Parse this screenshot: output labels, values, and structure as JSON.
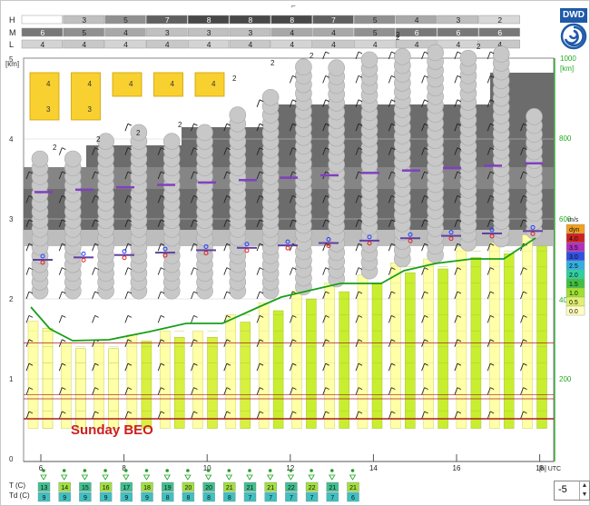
{
  "logo": {
    "text": "DWD",
    "icon": "dwd-swirl-icon",
    "color": "#1f5aa8"
  },
  "cloud_rows": [
    {
      "label": "H",
      "values": [
        "",
        "3",
        "5",
        "7",
        "8",
        "8",
        "8",
        "7",
        "5",
        "4",
        "3",
        "2"
      ]
    },
    {
      "label": "M",
      "values": [
        "6",
        "5",
        "4",
        "3",
        "3",
        "3",
        "4",
        "4",
        "5",
        "6",
        "6",
        "6"
      ]
    },
    {
      "label": "L",
      "values": [
        "4",
        "4",
        "4",
        "4",
        "4",
        "4",
        "4",
        "4",
        "4",
        "4",
        "4",
        "4"
      ]
    }
  ],
  "extra_M_label": "2",
  "km_axis": {
    "unit": "[km]",
    "ticks": [
      "5",
      "4",
      "3",
      "2",
      "1",
      "0"
    ]
  },
  "right_axis": {
    "unit": "[km]",
    "ticks": [
      "1000",
      "800",
      "600",
      "400",
      "200"
    ]
  },
  "time_axis": {
    "ticks": [
      "6",
      "8",
      "10",
      "12",
      "14",
      "16",
      "18"
    ],
    "unit": "[h] UTC"
  },
  "legend": {
    "title": "m/s",
    "items": [
      {
        "label": "dyn",
        "color": "#f0a020"
      },
      {
        "label": "4.0",
        "color": "#cc2222"
      },
      {
        "label": "3.5",
        "color": "#b030c0"
      },
      {
        "label": "3.0",
        "color": "#3050e0"
      },
      {
        "label": "2.5",
        "color": "#30b0e0"
      },
      {
        "label": "2.0",
        "color": "#30d0a0"
      },
      {
        "label": "1.5",
        "color": "#40c040"
      },
      {
        "label": "1.0",
        "color": "#a0e030"
      },
      {
        "label": "0.5",
        "color": "#e0f070"
      },
      {
        "label": "0.0",
        "color": "#ffffc0"
      }
    ]
  },
  "annotation": "Sunday BEO",
  "cloud_octas_boxes": [
    {
      "top": "4",
      "bottom": "3"
    },
    {
      "top": "4",
      "bottom": "3"
    },
    {
      "top": "4",
      "bottom": ""
    },
    {
      "top": "4",
      "bottom": ""
    },
    {
      "top": "4",
      "bottom": ""
    }
  ],
  "small_labels": [
    "2",
    "2",
    "2",
    "2",
    "2",
    "2",
    "2",
    "2",
    "2"
  ],
  "temperature": {
    "t_label": "T (C)",
    "td_label": "Td (C)",
    "t_values": [
      "13",
      "14",
      "15",
      "16",
      "17",
      "18",
      "19",
      "20",
      "20",
      "21",
      "21",
      "21",
      "22",
      "22",
      "21",
      "21"
    ],
    "td_values": [
      "9",
      "9",
      "9",
      "9",
      "9",
      "9",
      "8",
      "8",
      "8",
      "8",
      "7",
      "7",
      "7",
      "7",
      "7",
      "6"
    ],
    "t_colors": [
      "#40c090",
      "#a0e040"
    ]
  },
  "stepper": {
    "value": "-5"
  },
  "colors": {
    "cloud_gray": "#c8c8c8",
    "dark_band": "#686868",
    "panel_green": "#22aa22",
    "thermal_line": "#18a018",
    "red_line": "#aa2020"
  }
}
